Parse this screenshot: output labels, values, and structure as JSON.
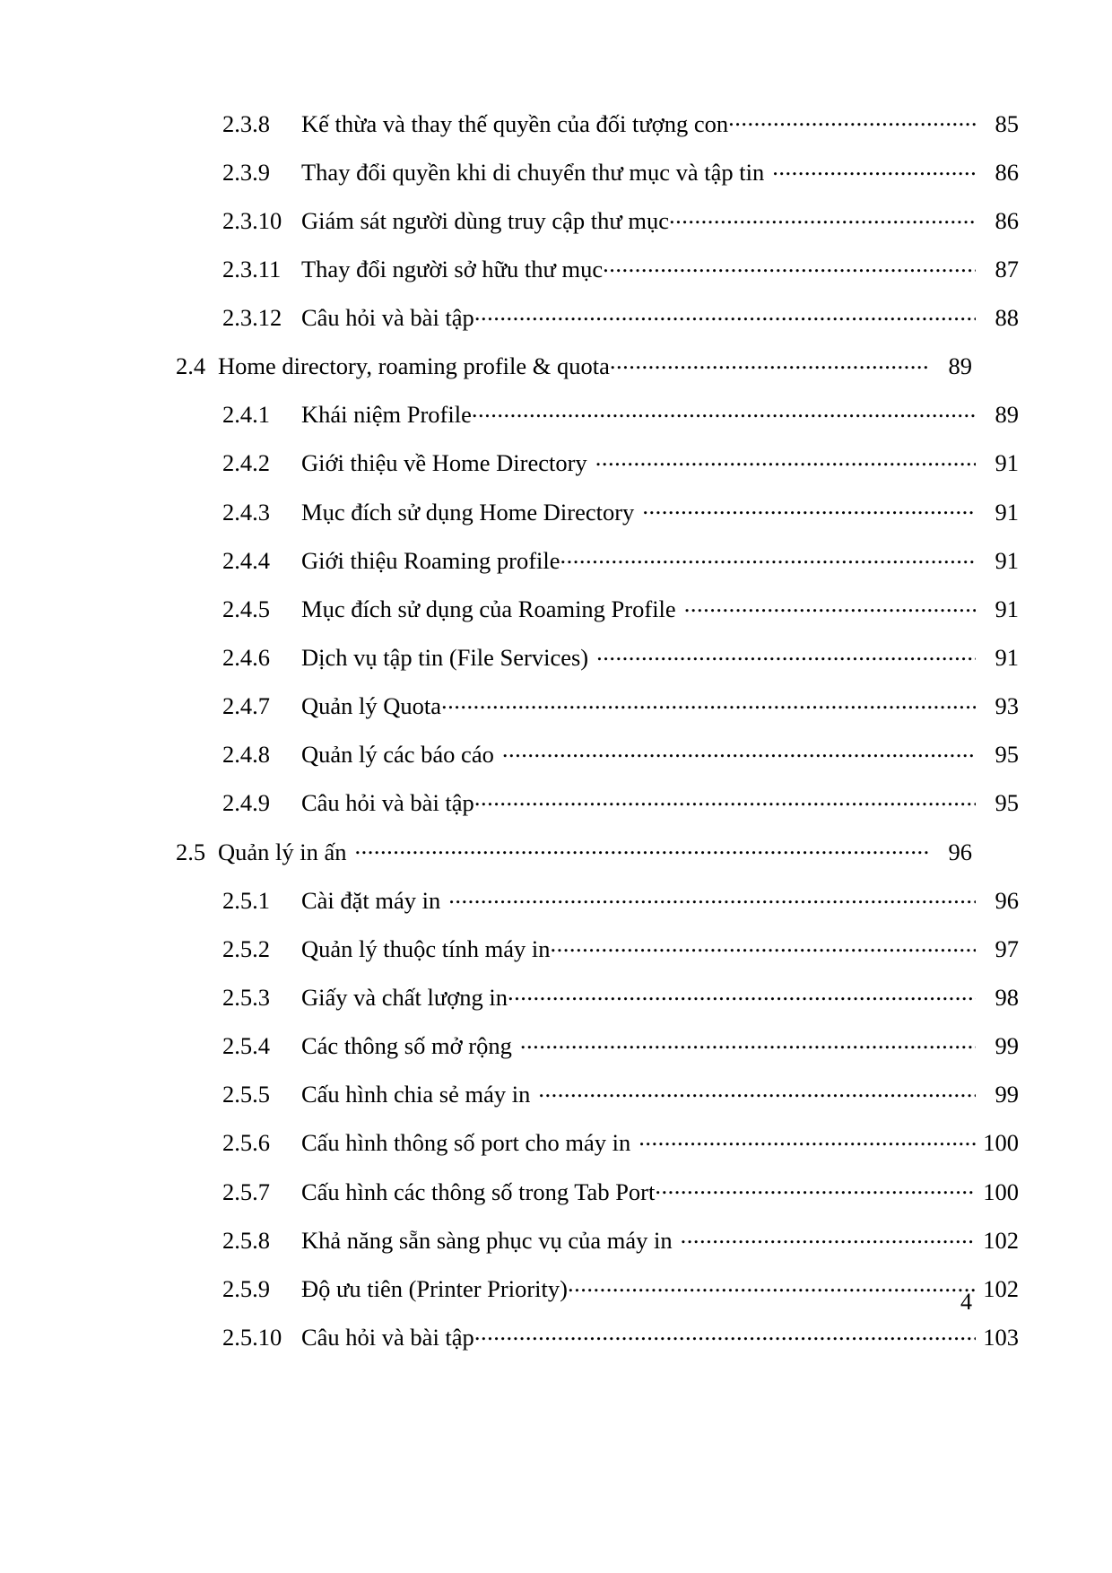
{
  "document": {
    "type": "table-of-contents",
    "language": "vi",
    "footer_page_number": "4"
  },
  "toc": {
    "entries": [
      {
        "level": 3,
        "number": "2.3.8",
        "title": "Kế thừa và thay thế quyền của đối tượng con",
        "page": "85",
        "space_before_leader": false
      },
      {
        "level": 3,
        "number": "2.3.9",
        "title": "Thay đổi quyền khi di chuyển thư mục và tập tin",
        "page": "86",
        "space_before_leader": true
      },
      {
        "level": 3,
        "number": "2.3.10",
        "title": "Giám sát người dùng truy cập thư mục",
        "page": "86",
        "space_before_leader": false
      },
      {
        "level": 3,
        "number": "2.3.11",
        "title": "Thay đổi người sở hữu thư mục",
        "page": "87",
        "space_before_leader": false
      },
      {
        "level": 3,
        "number": "2.3.12",
        "title": "Câu hỏi và bài tập",
        "page": "88",
        "space_before_leader": false
      },
      {
        "level": 2,
        "number": "2.4",
        "title": "Home directory, roaming profile & quota",
        "page": "89",
        "space_before_leader": false
      },
      {
        "level": 3,
        "number": "2.4.1",
        "title": "Khái niệm Profile",
        "page": "89",
        "space_before_leader": false
      },
      {
        "level": 3,
        "number": "2.4.2",
        "title": "Giới thiệu về Home Directory",
        "page": "91",
        "space_before_leader": true
      },
      {
        "level": 3,
        "number": "2.4.3",
        "title": "Mục đích sử dụng Home Directory",
        "page": "91",
        "space_before_leader": true
      },
      {
        "level": 3,
        "number": "2.4.4",
        "title": "Giới thiệu Roaming profile",
        "page": "91",
        "space_before_leader": false
      },
      {
        "level": 3,
        "number": "2.4.5",
        "title": "Mục đích sử dụng của Roaming Profile",
        "page": "91",
        "space_before_leader": true
      },
      {
        "level": 3,
        "number": "2.4.6",
        "title": "Dịch vụ tập tin (File Services)",
        "page": "91",
        "space_before_leader": true
      },
      {
        "level": 3,
        "number": "2.4.7",
        "title": "Quản lý Quota",
        "page": "93",
        "space_before_leader": false
      },
      {
        "level": 3,
        "number": "2.4.8",
        "title": "Quản lý các báo cáo",
        "page": "95",
        "space_before_leader": true
      },
      {
        "level": 3,
        "number": "2.4.9",
        "title": "Câu hỏi và bài tập",
        "page": "95",
        "space_before_leader": false
      },
      {
        "level": 2,
        "number": "2.5",
        "title": "Quản lý in ấn",
        "page": "96",
        "space_before_leader": true
      },
      {
        "level": 3,
        "number": "2.5.1",
        "title": "Cài đặt máy in",
        "page": "96",
        "space_before_leader": true
      },
      {
        "level": 3,
        "number": "2.5.2",
        "title": "Quản lý thuộc tính máy in",
        "page": "97",
        "space_before_leader": false
      },
      {
        "level": 3,
        "number": "2.5.3",
        "title": "Giấy và chất lượng in",
        "page": "98",
        "space_before_leader": false
      },
      {
        "level": 3,
        "number": "2.5.4",
        "title": "Các thông số mở rộng",
        "page": "99",
        "space_before_leader": true
      },
      {
        "level": 3,
        "number": "2.5.5",
        "title": "Cấu hình chia sẻ máy in",
        "page": "99",
        "space_before_leader": true
      },
      {
        "level": 3,
        "number": "2.5.6",
        "title": "Cấu hình thông số port cho máy in",
        "page": "100",
        "space_before_leader": true
      },
      {
        "level": 3,
        "number": "2.5.7",
        "title": "Cấu hình các thông số trong Tab Port",
        "page": "100",
        "space_before_leader": false
      },
      {
        "level": 3,
        "number": "2.5.8",
        "title": "Khả năng sẵn sàng phục vụ của máy in",
        "page": "102",
        "space_before_leader": true
      },
      {
        "level": 3,
        "number": "2.5.9",
        "title": "Độ ưu tiên (Printer Priority)",
        "page": "102",
        "space_before_leader": false
      },
      {
        "level": 3,
        "number": "2.5.10",
        "title": "Câu hỏi và bài tập",
        "page": "103",
        "space_before_leader": false
      }
    ]
  }
}
